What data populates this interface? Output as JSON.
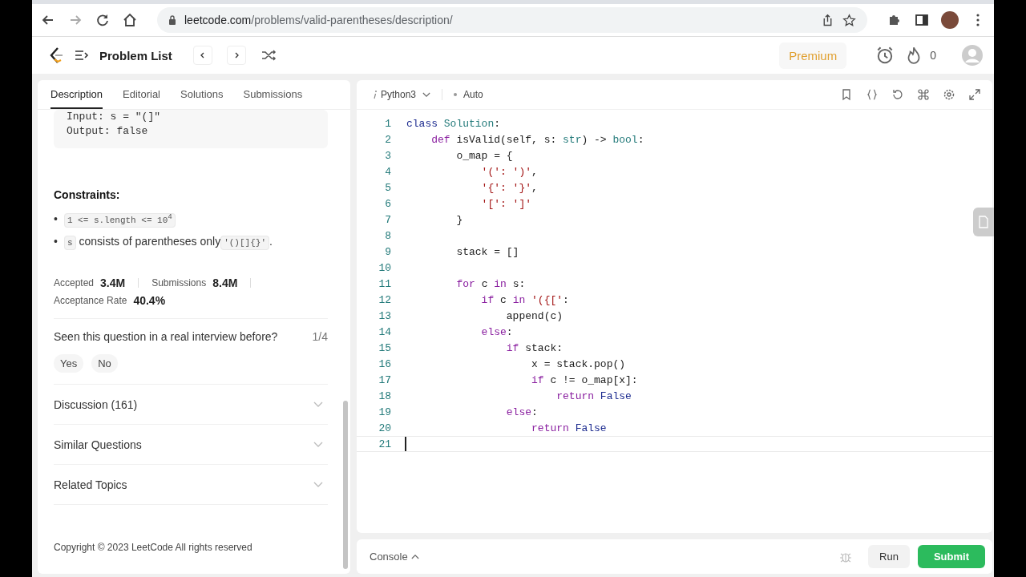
{
  "browser": {
    "url_host": "leetcode.com",
    "url_path": "/problems/valid-parentheses/description/"
  },
  "nav": {
    "title": "Problem List",
    "premium": "Premium",
    "streak": "0"
  },
  "tabs": [
    {
      "label": "Description",
      "selected": true
    },
    {
      "label": "Editorial",
      "selected": false
    },
    {
      "label": "Solutions",
      "selected": false
    },
    {
      "label": "Submissions",
      "selected": false
    }
  ],
  "example": [
    "Input: s = \"(]\"",
    "Output: false"
  ],
  "constraints": {
    "title": "Constraints:",
    "items": [
      {
        "kind": "code",
        "bullet": "•",
        "text": "1 <= s.length <= 10$^{4}$"
      },
      {
        "kind": "mixed",
        "bullet": "•",
        "code": "s",
        "text": "consists of parentheses only",
        "code2": "'()[]{}'",
        "tail": "."
      }
    ]
  },
  "stats": [
    {
      "label": "Accepted",
      "value": "3.4M"
    },
    {
      "label": "Submissions",
      "value": "8.4M"
    },
    {
      "label": "Acceptance Rate",
      "value": "40.4%"
    }
  ],
  "interview": {
    "question": "Seen this question in a real interview before?",
    "count": "1/4",
    "answers": [
      "Yes",
      "No"
    ]
  },
  "sections": [
    {
      "label": "Discussion (161)",
      "expanded": false
    },
    {
      "label": "Similar Questions",
      "expanded": false
    },
    {
      "label": "Related Topics",
      "expanded": false
    }
  ],
  "copyright": "Copyright © 2023 LeetCode All rights reserved",
  "editor": {
    "language": "Python3",
    "mode": "Auto",
    "lines": [
      {
        "number": "1",
        "tokens": [
          {
            "text": "class ",
            "kind": "constant"
          },
          {
            "text": "Solution",
            "kind": "type"
          },
          {
            "text": ":",
            "kind": "plain"
          }
        ]
      },
      {
        "number": "2",
        "tokens": [
          {
            "text": "    def ",
            "kind": "keyword"
          },
          {
            "text": "isValid(self, s: ",
            "kind": "plain"
          },
          {
            "text": "str",
            "kind": "type"
          },
          {
            "text": ") -> ",
            "kind": "plain"
          },
          {
            "text": "bool",
            "kind": "type"
          },
          {
            "text": ":",
            "kind": "plain"
          }
        ]
      },
      {
        "number": "3",
        "tokens": [
          {
            "text": "        o_map = {",
            "kind": "plain"
          }
        ]
      },
      {
        "number": "4",
        "tokens": [
          {
            "text": "            '(': ')'",
            "kind": "string"
          },
          {
            "text": ",",
            "kind": "plain"
          }
        ]
      },
      {
        "number": "5",
        "tokens": [
          {
            "text": "            '{': '}'",
            "kind": "string"
          },
          {
            "text": ",",
            "kind": "plain"
          }
        ]
      },
      {
        "number": "6",
        "tokens": [
          {
            "text": "            '[': ']'",
            "kind": "string"
          }
        ]
      },
      {
        "number": "7",
        "tokens": [
          {
            "text": "        }",
            "kind": "plain"
          }
        ]
      },
      {
        "number": "8"
      },
      {
        "number": "9",
        "tokens": [
          {
            "text": "        stack = []",
            "kind": "plain"
          }
        ]
      },
      {
        "number": "10"
      },
      {
        "number": "11",
        "tokens": [
          {
            "text": "        for ",
            "kind": "keyword"
          },
          {
            "text": "c ",
            "kind": "plain"
          },
          {
            "text": "in ",
            "kind": "keyword"
          },
          {
            "text": "s:",
            "kind": "plain"
          }
        ]
      },
      {
        "number": "12",
        "tokens": [
          {
            "text": "            if ",
            "kind": "keyword"
          },
          {
            "text": "c ",
            "kind": "plain"
          },
          {
            "text": "in ",
            "kind": "keyword"
          },
          {
            "text": "'({['",
            "kind": "string"
          },
          {
            "text": ":",
            "kind": "plain"
          }
        ]
      },
      {
        "number": "13",
        "tokens": [
          {
            "text": "                append(c)",
            "kind": "plain"
          }
        ]
      },
      {
        "number": "14",
        "tokens": [
          {
            "text": "            else",
            "kind": "keyword"
          },
          {
            "text": ":",
            "kind": "plain"
          }
        ]
      },
      {
        "number": "15",
        "tokens": [
          {
            "text": "                if ",
            "kind": "keyword"
          },
          {
            "text": "stack:",
            "kind": "plain"
          }
        ]
      },
      {
        "number": "16",
        "tokens": [
          {
            "text": "                    x = stack.pop()",
            "kind": "plain"
          }
        ]
      },
      {
        "number": "17",
        "tokens": [
          {
            "text": "                    if ",
            "kind": "keyword"
          },
          {
            "text": "c != o_map[x]:",
            "kind": "plain"
          }
        ]
      },
      {
        "number": "18",
        "tokens": [
          {
            "text": "                        return ",
            "kind": "keyword"
          },
          {
            "text": "False",
            "kind": "constant"
          }
        ]
      },
      {
        "number": "19",
        "tokens": [
          {
            "text": "                else",
            "kind": "keyword"
          },
          {
            "text": ":",
            "kind": "plain"
          }
        ]
      },
      {
        "number": "20",
        "tokens": [
          {
            "text": "                    return ",
            "kind": "keyword"
          },
          {
            "text": "False",
            "kind": "constant"
          }
        ]
      },
      {
        "number": "21",
        "current": true
      }
    ]
  },
  "console": {
    "label": "Console",
    "run": "Run",
    "submit": "Submit"
  }
}
